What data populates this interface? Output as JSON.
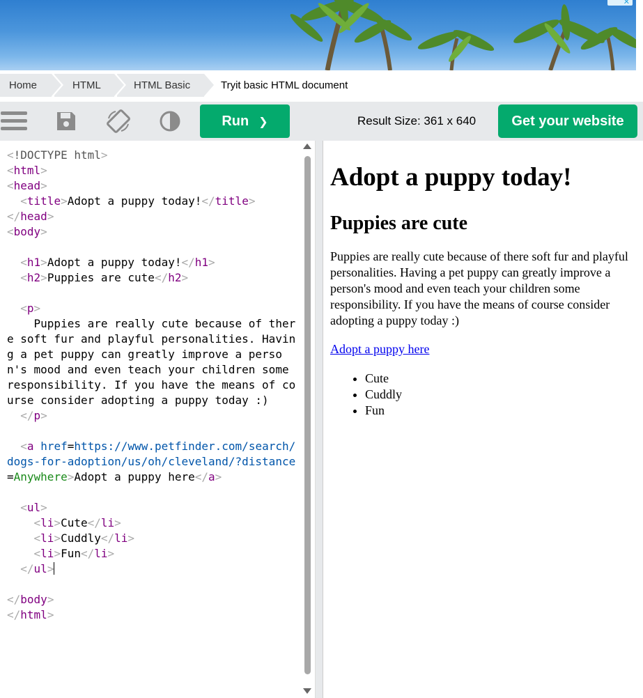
{
  "ad": {
    "close_glyph": "✕"
  },
  "breadcrumb": {
    "items": [
      "Home",
      "HTML",
      "HTML Basic"
    ],
    "current": "Tryit basic HTML document"
  },
  "toolbar": {
    "icons": [
      "menu-icon",
      "save-icon",
      "rotate-icon",
      "contrast-icon"
    ],
    "run_label": "Run",
    "run_chevron": "❯",
    "result_size": "Result Size: 361 x 640",
    "get_website_label": "Get your website",
    "accent_color": "#04aa6d"
  },
  "editor": {
    "lines": [
      "<!DOCTYPE html>",
      "<html>",
      "<head>",
      "  <title>Adopt a puppy today!</title>",
      "</head>",
      "<body>",
      "",
      "  <h1>Adopt a puppy today!</h1>",
      "  <h2>Puppies are cute</h2>",
      "",
      "  <p>",
      "    Puppies are really cute because of there soft fur and playful personalities. Having a pet puppy can greatly improve a person's mood and even teach your children some responsibility. If you have the means of course consider adopting a puppy today :)",
      "  </p>",
      "",
      "  <a href=https://www.petfinder.com/search/dogs-for-adoption/us/oh/cleveland/?distance=Anywhere>Adopt a puppy here</a>",
      "",
      "  <ul>",
      "    <li>Cute</li>",
      "    <li>Cuddly</li>",
      "    <li>Fun</li>",
      "  </ul>",
      "",
      "</body>",
      "</html>"
    ]
  },
  "result": {
    "h1": "Adopt a puppy today!",
    "h2": "Puppies are cute",
    "paragraph": "Puppies are really cute because of there soft fur and playful personalities. Having a pet puppy can greatly improve a person's mood and even teach your children some responsibility. If you have the means of course consider adopting a puppy today :)",
    "link_text": "Adopt a puppy here",
    "list": [
      "Cute",
      "Cuddly",
      "Fun"
    ]
  }
}
